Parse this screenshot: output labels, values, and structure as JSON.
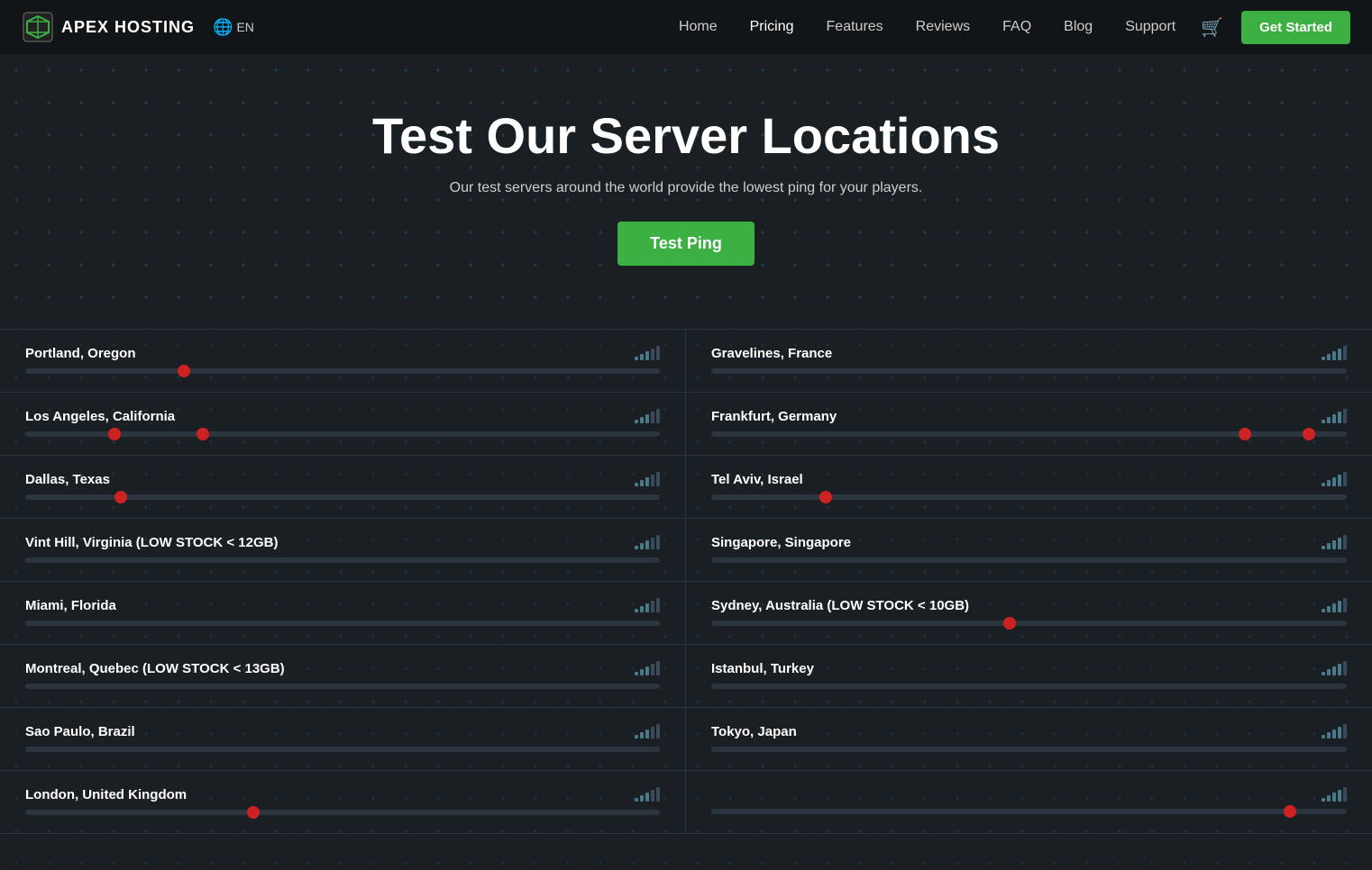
{
  "nav": {
    "logo_text": "APEX HOSTING",
    "lang": "EN",
    "links": [
      {
        "label": "Home",
        "active": false
      },
      {
        "label": "Pricing",
        "active": true
      },
      {
        "label": "Features",
        "active": false
      },
      {
        "label": "Reviews",
        "active": false
      },
      {
        "label": "FAQ",
        "active": false
      },
      {
        "label": "Blog",
        "active": false
      },
      {
        "label": "Support",
        "active": false
      }
    ],
    "cta_label": "Get Started"
  },
  "hero": {
    "title": "Test Our Server Locations",
    "subtitle": "Our test servers around the world provide the lowest ping for your players.",
    "ping_button": "Test Ping"
  },
  "locations_left": [
    {
      "name": "Portland, Oregon",
      "dot1": 24,
      "dot2": null,
      "signal": 3
    },
    {
      "name": "Los Angeles, California",
      "dot1": 13,
      "dot2": 27,
      "signal": 3
    },
    {
      "name": "Dallas, Texas",
      "dot1": 14,
      "dot2": null,
      "signal": 3
    },
    {
      "name": "Vint Hill, Virginia (LOW STOCK < 12GB)",
      "dot1": null,
      "dot2": null,
      "signal": 3
    },
    {
      "name": "Miami, Florida",
      "dot1": null,
      "dot2": null,
      "signal": 3
    },
    {
      "name": "Montreal, Quebec (LOW STOCK < 13GB)",
      "dot1": null,
      "dot2": null,
      "signal": 3
    },
    {
      "name": "Sao Paulo, Brazil",
      "dot1": null,
      "dot2": null,
      "signal": 3
    },
    {
      "name": "London, United Kingdom",
      "dot1": 35,
      "dot2": null,
      "signal": 3
    }
  ],
  "locations_right": [
    {
      "name": "Gravelines, France",
      "dot1": null,
      "dot2": null,
      "signal": 4
    },
    {
      "name": "Frankfurt, Germany",
      "dot1": 83,
      "dot2": 93,
      "signal": 4
    },
    {
      "name": "Tel Aviv, Israel",
      "dot1": 17,
      "dot2": null,
      "signal": 4
    },
    {
      "name": "Singapore, Singapore",
      "dot1": null,
      "dot2": null,
      "signal": 4
    },
    {
      "name": "Sydney, Australia (LOW STOCK < 10GB)",
      "dot1": 46,
      "dot2": null,
      "signal": 4
    },
    {
      "name": "Istanbul, Turkey",
      "dot1": null,
      "dot2": null,
      "signal": 4
    },
    {
      "name": "Tokyo, Japan",
      "dot1": null,
      "dot2": null,
      "signal": 4
    },
    {
      "name": "",
      "dot1": 90,
      "dot2": null,
      "signal": 4
    }
  ]
}
